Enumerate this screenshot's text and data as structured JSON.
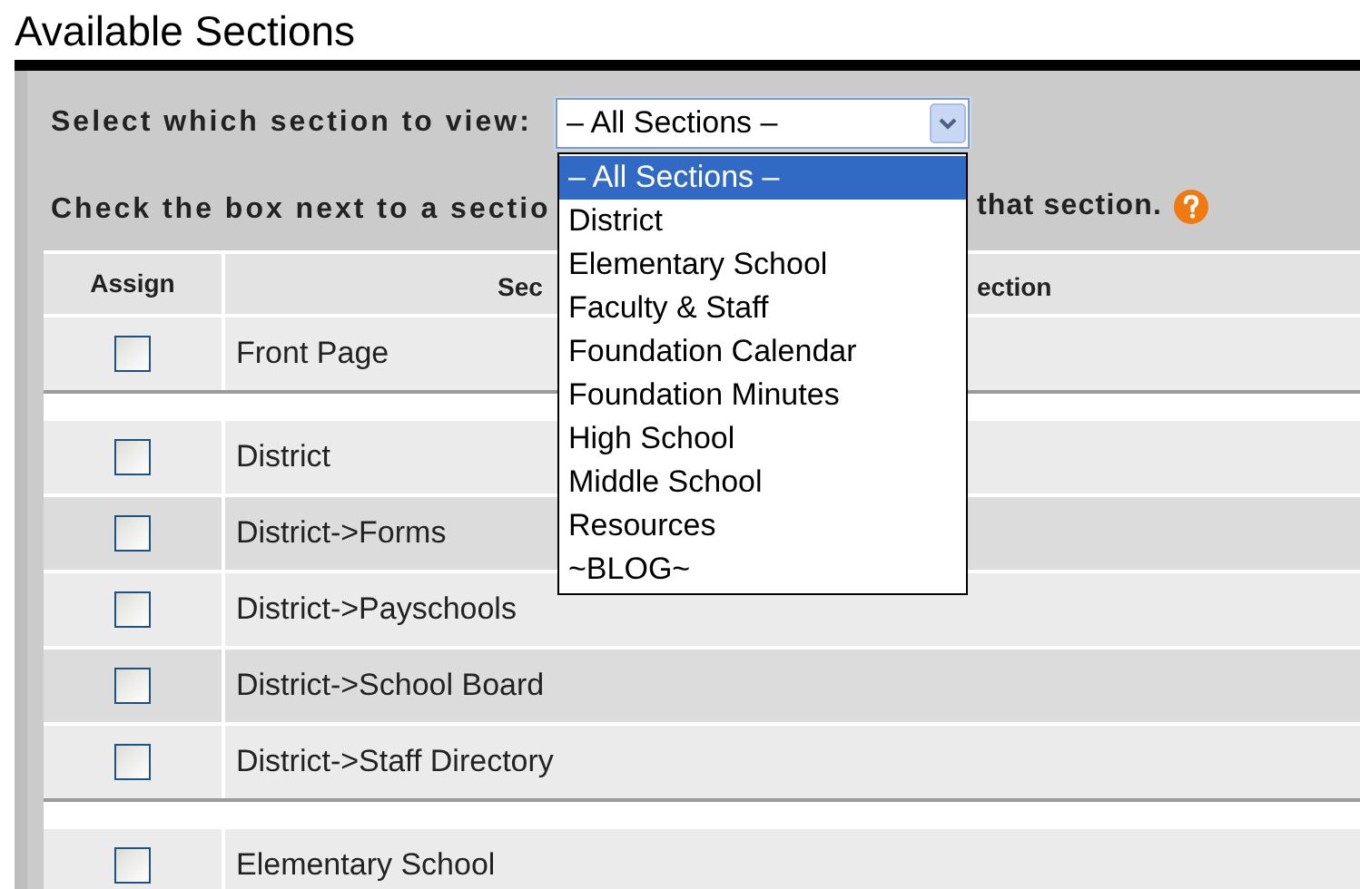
{
  "title": "Available Sections",
  "filter": {
    "label": "Select which section to view:",
    "value": "– All Sections –",
    "expanded": true
  },
  "instruction": {
    "left_fragment": "Check the box next to a sectio",
    "right_fragment": "that section."
  },
  "table": {
    "columns": [
      {
        "label": "Assign"
      },
      {
        "label_left_fragment": "Sec",
        "label_right_fragment": "ection"
      }
    ],
    "rows": [
      {
        "kind": "section",
        "name": "Front Page",
        "checked": false
      },
      {
        "kind": "separator"
      },
      {
        "kind": "section",
        "name": "District",
        "checked": false
      },
      {
        "kind": "section",
        "name": "District->Forms",
        "checked": false
      },
      {
        "kind": "section",
        "name": "District->Payschools",
        "checked": false
      },
      {
        "kind": "section",
        "name": "District->School Board",
        "checked": false
      },
      {
        "kind": "section",
        "name": "District->Staff Directory",
        "checked": false
      },
      {
        "kind": "separator"
      },
      {
        "kind": "section",
        "name": "Elementary School",
        "checked": false
      }
    ]
  },
  "dropdown_options": [
    {
      "label": "– All Sections –",
      "selected": true
    },
    {
      "label": "District",
      "selected": false
    },
    {
      "label": "Elementary School",
      "selected": false
    },
    {
      "label": "Faculty & Staff",
      "selected": false
    },
    {
      "label": "Foundation Calendar",
      "selected": false
    },
    {
      "label": "Foundation Minutes",
      "selected": false
    },
    {
      "label": "High School",
      "selected": false
    },
    {
      "label": "Middle School",
      "selected": false
    },
    {
      "label": "Resources",
      "selected": false
    },
    {
      "label": "~BLOG~",
      "selected": false
    }
  ]
}
